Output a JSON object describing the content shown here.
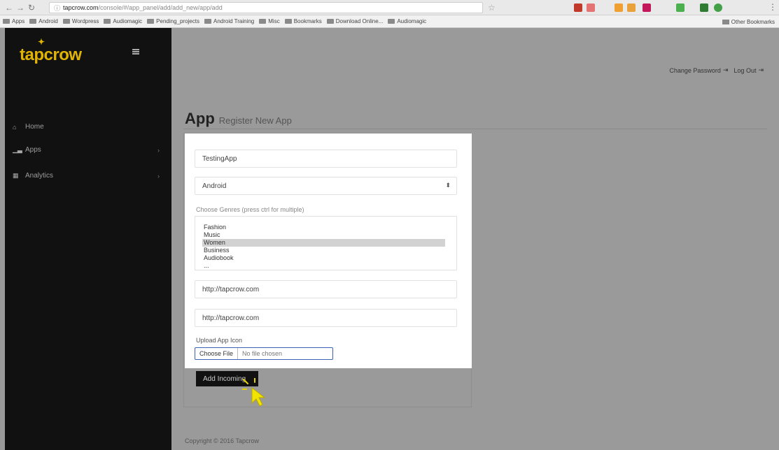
{
  "browser": {
    "url_host": "tapcrow.com",
    "url_path": "/console/#/app_panel/add/add_new/app/add",
    "bookmarks": [
      "Apps",
      "Android",
      "Wordpress",
      "Audiomagic",
      "Pending_projects",
      "Android Training",
      "Misc",
      "Bookmarks",
      "Download Online...",
      "Audiomagic"
    ],
    "other_bookmarks": "Other Bookmarks"
  },
  "sidebar": {
    "logo": "tapcrow",
    "items": [
      {
        "label": "Home",
        "icon": "home-icon"
      },
      {
        "label": "Apps",
        "icon": "chart-icon",
        "chevron": "›"
      },
      {
        "label": "Analytics",
        "icon": "grid-icon",
        "chevron": "›"
      }
    ]
  },
  "header": {
    "change_password": "Change Password",
    "log_out": "Log Out"
  },
  "page": {
    "title": "App",
    "subtitle": "Register New App"
  },
  "form": {
    "app_name_value": "TestingApp",
    "platform_value": "Android",
    "genres_help": "Choose Genres (press ctrl for multiple)",
    "genres_options": [
      "Fashion",
      "Music",
      "Women",
      "Business",
      "Audiobook",
      "..."
    ],
    "genres_selected_index": 2,
    "url1_value": "http://tapcrow.com",
    "url2_value": "http://tapcrow.com",
    "upload_label": "Upload App Icon",
    "choose_file": "Choose File",
    "no_file": "No file chosen",
    "submit_label": "Add Incoming"
  },
  "footer": {
    "copyright": "Copyright © 2016 Tapcrow"
  },
  "colors": {
    "accent": "#e0b400",
    "sidebar_bg": "#111111",
    "overlay_bg": "#9a9a9a"
  }
}
